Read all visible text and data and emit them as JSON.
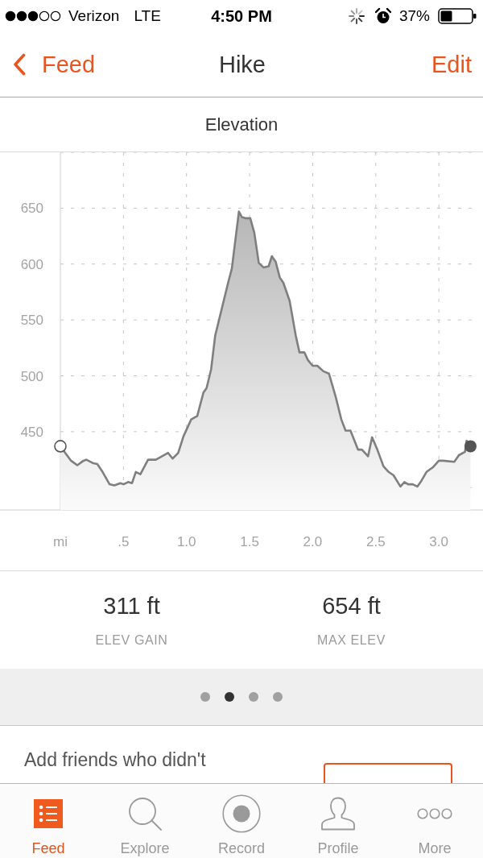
{
  "status_bar": {
    "carrier": "Verizon",
    "network": "LTE",
    "time": "4:50 PM",
    "battery": "37%"
  },
  "nav_bar": {
    "back_label": "Feed",
    "title": "Hike",
    "action": "Edit"
  },
  "elevation_card": {
    "chart_data": {
      "type": "area",
      "title": "Elevation",
      "grid": true,
      "x": [
        0,
        0.085,
        0.134,
        0.183,
        0.207,
        0.256,
        0.293,
        0.329,
        0.39,
        0.427,
        0.476,
        0.5,
        0.537,
        0.568,
        0.598,
        0.634,
        0.695,
        0.756,
        0.805,
        0.854,
        0.89,
        0.934,
        0.976,
        1.037,
        1.085,
        1.134,
        1.159,
        1.195,
        1.227,
        1.329,
        1.359,
        1.415,
        1.439,
        1.471,
        1.505,
        1.537,
        1.573,
        1.61,
        1.651,
        1.676,
        1.707,
        1.739,
        1.768,
        1.817,
        1.866,
        1.895,
        1.934,
        1.963,
        2.0,
        2.037,
        2.085,
        2.129,
        2.183,
        2.227,
        2.261,
        2.3,
        2.359,
        2.39,
        2.439,
        2.471,
        2.512,
        2.561,
        2.602,
        2.641,
        2.695,
        2.727,
        2.756,
        2.793,
        2.829,
        2.861,
        2.902,
        2.951,
        3.0,
        3.037,
        3.122,
        3.159,
        3.207,
        3.22,
        3.251
      ],
      "values": [
        437,
        424,
        420,
        424,
        425,
        422,
        421,
        415,
        403,
        402,
        404,
        403,
        405,
        404,
        414,
        412,
        425,
        425,
        428,
        431,
        426,
        431,
        446,
        461,
        464,
        485,
        489,
        506,
        536,
        583,
        596,
        647,
        642,
        641,
        641,
        628,
        601,
        597,
        598,
        607,
        602,
        588,
        583,
        567,
        536,
        521,
        521,
        514,
        509,
        509,
        504,
        502,
        481,
        461,
        451,
        451,
        434,
        434,
        428,
        445,
        434,
        419,
        414,
        411,
        401,
        405,
        403,
        403,
        401,
        406,
        414,
        418,
        424,
        424,
        423,
        429,
        432,
        442,
        437
      ],
      "xlim": [
        0,
        3.35
      ],
      "ylim": [
        380,
        700
      ],
      "xticks": [
        {
          "value": 0,
          "label": "mi"
        },
        {
          "value": 0.5,
          "label": ".5"
        },
        {
          "value": 1,
          "label": "1.0"
        },
        {
          "value": 1.5,
          "label": "1.5"
        },
        {
          "value": 2,
          "label": "2.0"
        },
        {
          "value": 2.5,
          "label": "2.5"
        },
        {
          "value": 3,
          "label": "3.0"
        }
      ],
      "yticks": [
        450,
        500,
        550,
        600,
        650
      ]
    }
  },
  "stats": [
    {
      "value": "311 ft",
      "label": "ELEV GAIN"
    },
    {
      "value": "654 ft",
      "label": "MAX ELEV"
    }
  ],
  "pager": [
    {
      "selected": false
    },
    {
      "selected": true
    },
    {
      "selected": false
    },
    {
      "selected": false
    }
  ],
  "promo": {
    "text": "Add friends who didn't"
  },
  "tab_bar": [
    {
      "kind": "feed",
      "label": "Feed",
      "selected": true
    },
    {
      "kind": "explore",
      "label": "Explore",
      "selected": false
    },
    {
      "kind": "record",
      "label": "Record",
      "selected": false
    },
    {
      "kind": "profile",
      "label": "Profile",
      "selected": false
    },
    {
      "kind": "more",
      "label": "More",
      "selected": false
    }
  ]
}
